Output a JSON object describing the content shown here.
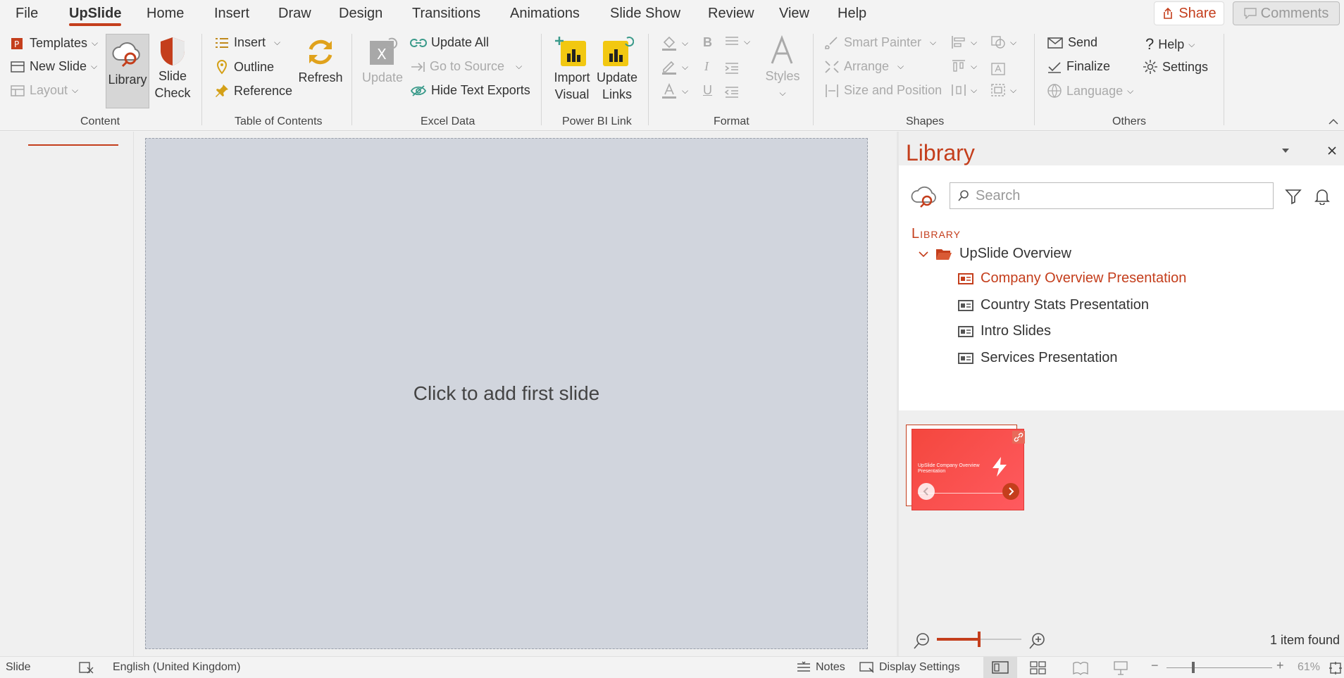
{
  "menu": {
    "items": [
      "File",
      "UpSlide",
      "Home",
      "Insert",
      "Draw",
      "Design",
      "Transitions",
      "Animations",
      "Slide Show",
      "Review",
      "View",
      "Help"
    ],
    "active": "UpSlide",
    "share": "Share",
    "comments": "Comments"
  },
  "ribbon": {
    "content": {
      "label": "Content",
      "templates": "Templates",
      "new_slide": "New Slide",
      "layout": "Layout",
      "library": "Library",
      "slide_check_1": "Slide",
      "slide_check_2": "Check"
    },
    "toc": {
      "label": "Table of Contents",
      "insert": "Insert",
      "outline": "Outline",
      "reference": "Reference",
      "refresh": "Refresh"
    },
    "excel": {
      "label": "Excel Data",
      "update": "Update",
      "update_all": "Update All",
      "go_to_source": "Go to Source",
      "hide_text_exports": "Hide Text Exports"
    },
    "powerbi": {
      "label": "Power BI Link",
      "import_1": "Import",
      "import_2": "Visual",
      "update_1": "Update",
      "update_2": "Links"
    },
    "format": {
      "label": "Format",
      "styles": "Styles"
    },
    "shapes": {
      "label": "Shapes",
      "smart_painter": "Smart Painter",
      "arrange": "Arrange",
      "size_position": "Size and Position"
    },
    "others": {
      "label": "Others",
      "send": "Send",
      "finalize": "Finalize",
      "language": "Language",
      "help": "Help",
      "settings": "Settings"
    }
  },
  "slide": {
    "placeholder": "Click to add first slide"
  },
  "library": {
    "title": "Library",
    "search_placeholder": "Search",
    "heading": "Library",
    "folder": "UpSlide Overview",
    "items": [
      {
        "label": "Company Overview Presentation",
        "selected": true
      },
      {
        "label": "Country Stats Presentation",
        "selected": false
      },
      {
        "label": "Intro Slides",
        "selected": false
      },
      {
        "label": "Services Presentation",
        "selected": false
      }
    ],
    "preview_title": "UpSlide Company Overview Presentation",
    "found": "1 item found"
  },
  "status": {
    "slide": "Slide",
    "language": "English (United Kingdom)",
    "notes": "Notes",
    "display_settings": "Display Settings",
    "zoom": "61%"
  },
  "colors": {
    "accent": "#c43e1c",
    "slide_bg": "#d1d5dd",
    "powerbi": "#f2c811"
  }
}
